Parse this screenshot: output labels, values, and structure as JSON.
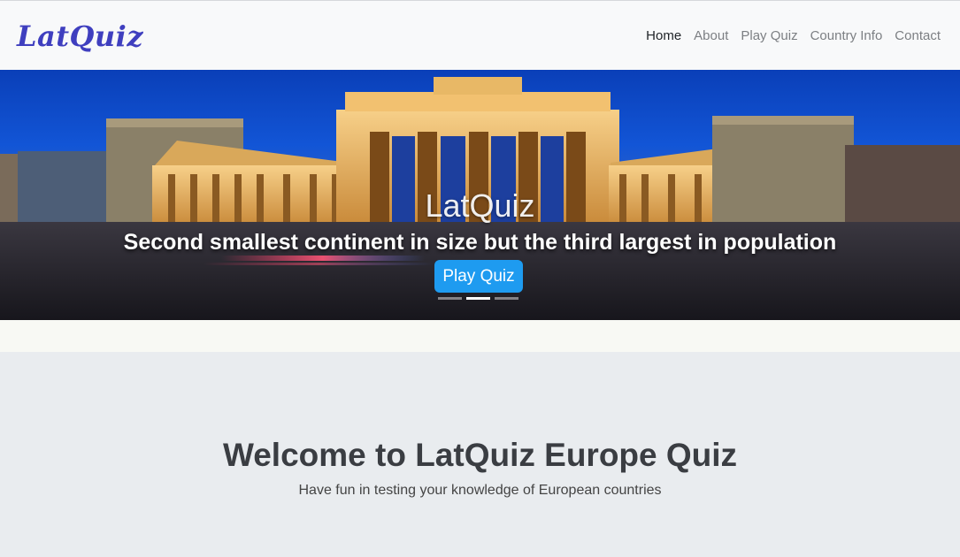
{
  "navbar": {
    "brand": "LatQuiz",
    "links": [
      {
        "label": "Home",
        "active": true
      },
      {
        "label": "About",
        "active": false
      },
      {
        "label": "Play Quiz",
        "active": false
      },
      {
        "label": "Country Info",
        "active": false
      },
      {
        "label": "Contact",
        "active": false
      }
    ]
  },
  "carousel": {
    "caption_title": "LatQuiz",
    "caption_text": "Second smallest continent in size but the third largest in population",
    "button_label": "Play Quiz",
    "active_slide": 1,
    "slide_count": 3
  },
  "jumbotron": {
    "heading": "Welcome to LatQuiz Europe Quiz",
    "lead": "Have fun in testing your knowledge of European countries"
  },
  "colors": {
    "brand": "#3f3fbf",
    "button": "#1e9bf0",
    "navbar_bg": "#f8f9fa",
    "jumbotron_bg": "#e9ecef"
  }
}
